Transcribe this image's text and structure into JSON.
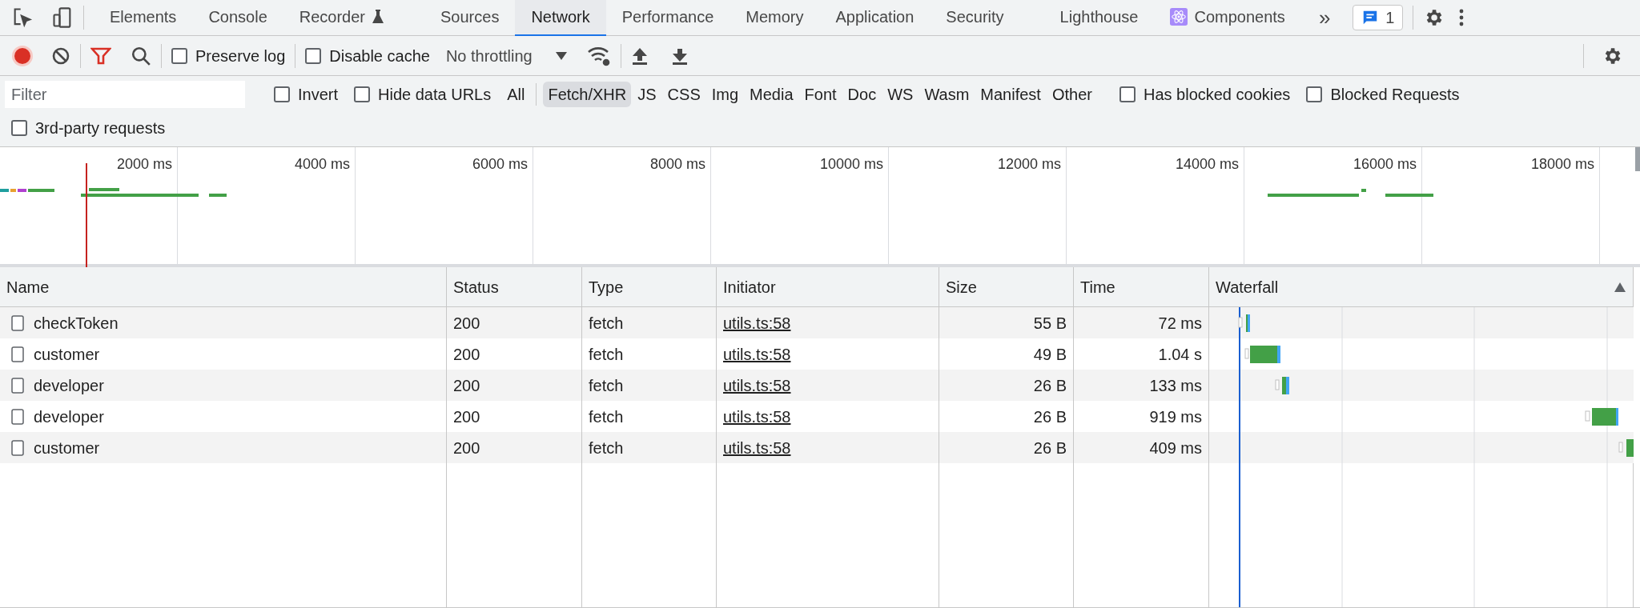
{
  "tabs": [
    {
      "label": "Elements",
      "selected": false,
      "kind": "plain"
    },
    {
      "label": "Console",
      "selected": false,
      "kind": "plain"
    },
    {
      "label": "Recorder",
      "selected": false,
      "kind": "flask"
    },
    {
      "label": "Sources",
      "selected": false,
      "kind": "plain"
    },
    {
      "label": "Network",
      "selected": true,
      "kind": "plain"
    },
    {
      "label": "Performance",
      "selected": false,
      "kind": "plain"
    },
    {
      "label": "Memory",
      "selected": false,
      "kind": "plain"
    },
    {
      "label": "Application",
      "selected": false,
      "kind": "plain"
    },
    {
      "label": "Security",
      "selected": false,
      "kind": "plain"
    },
    {
      "label": "Lighthouse",
      "selected": false,
      "kind": "plain"
    },
    {
      "label": "Components",
      "selected": false,
      "kind": "react"
    }
  ],
  "more_tabs": "»",
  "issues_badge": "1",
  "toolbar": {
    "recording": true,
    "preserve_log": {
      "label": "Preserve log",
      "checked": false
    },
    "disable_cache": {
      "label": "Disable cache",
      "checked": false
    },
    "throttling": "No throttling"
  },
  "filter": {
    "placeholder": "Filter",
    "options": [
      {
        "label": "Invert",
        "checked": false
      },
      {
        "label": "Hide data URLs",
        "checked": false
      }
    ],
    "types": [
      {
        "label": "All",
        "selected": false
      },
      {
        "label": "Fetch/XHR",
        "selected": true
      },
      {
        "label": "JS",
        "selected": false
      },
      {
        "label": "CSS",
        "selected": false
      },
      {
        "label": "Img",
        "selected": false
      },
      {
        "label": "Media",
        "selected": false
      },
      {
        "label": "Font",
        "selected": false
      },
      {
        "label": "Doc",
        "selected": false
      },
      {
        "label": "WS",
        "selected": false
      },
      {
        "label": "Wasm",
        "selected": false
      },
      {
        "label": "Manifest",
        "selected": false
      },
      {
        "label": "Other",
        "selected": false
      }
    ],
    "extra_options": [
      {
        "label": "Has blocked cookies",
        "checked": false
      },
      {
        "label": "Blocked Requests",
        "checked": false
      },
      {
        "label": "3rd-party requests",
        "checked": false
      }
    ]
  },
  "timeline": {
    "ticks": [
      "2000 ms",
      "4000 ms",
      "6000 ms",
      "8000 ms",
      "10000 ms",
      "12000 ms",
      "14000 ms",
      "16000 ms",
      "18000 ms"
    ]
  },
  "table": {
    "columns": [
      "Name",
      "Status",
      "Type",
      "Initiator",
      "Size",
      "Time",
      "Waterfall"
    ],
    "rows": [
      {
        "name": "checkToken",
        "status": "200",
        "type": "fetch",
        "initiator": "utils.ts:58",
        "size": "55 B",
        "time": "72 ms"
      },
      {
        "name": "customer",
        "status": "200",
        "type": "fetch",
        "initiator": "utils.ts:58",
        "size": "49 B",
        "time": "1.04 s"
      },
      {
        "name": "developer",
        "status": "200",
        "type": "fetch",
        "initiator": "utils.ts:58",
        "size": "26 B",
        "time": "133 ms"
      },
      {
        "name": "developer",
        "status": "200",
        "type": "fetch",
        "initiator": "utils.ts:58",
        "size": "26 B",
        "time": "919 ms"
      },
      {
        "name": "customer",
        "status": "200",
        "type": "fetch",
        "initiator": "utils.ts:58",
        "size": "26 B",
        "time": "409 ms"
      }
    ]
  }
}
